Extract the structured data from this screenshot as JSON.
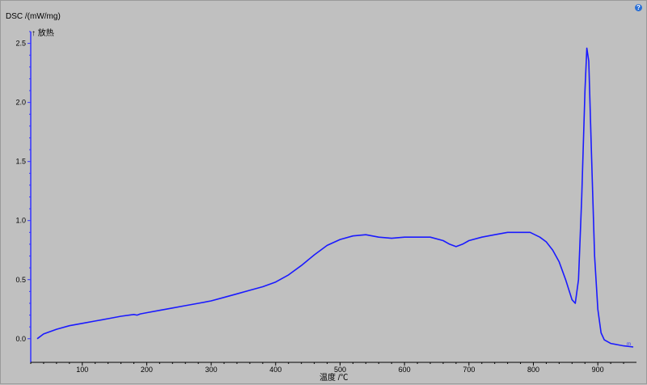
{
  "help_icon": "?",
  "chart_data": {
    "type": "line",
    "ylabel": "DSC /(mW/mg)",
    "exo_label": "↑ 放热",
    "xlabel": "温度 /℃",
    "xlim": [
      20,
      960
    ],
    "ylim": [
      -0.2,
      2.6
    ],
    "xticks": [
      100,
      200,
      300,
      400,
      500,
      600,
      700,
      800,
      900
    ],
    "yticks": [
      0.0,
      0.5,
      1.0,
      1.5,
      2.0,
      2.5
    ],
    "ytick_labels": [
      "0.0",
      "0.5",
      "1.0",
      "1.5",
      "2.0",
      "2.5"
    ],
    "grid": false,
    "line_color": "#1a1aff",
    "axis_color": "#3333ff",
    "end_marker": "m",
    "series": [
      {
        "x": [
          30,
          40,
          60,
          80,
          100,
          120,
          140,
          160,
          180,
          185,
          190,
          200,
          220,
          240,
          260,
          280,
          300,
          320,
          340,
          360,
          380,
          400,
          420,
          440,
          460,
          480,
          500,
          520,
          540,
          560,
          580,
          600,
          620,
          640,
          660,
          670,
          680,
          690,
          700,
          720,
          740,
          760,
          780,
          795,
          810,
          820,
          830,
          840,
          850,
          860,
          865,
          870,
          875,
          880,
          883,
          886,
          890,
          895,
          900,
          905,
          910,
          920,
          930,
          940,
          955
        ],
        "y": [
          0.0,
          0.04,
          0.08,
          0.11,
          0.13,
          0.15,
          0.17,
          0.19,
          0.205,
          0.2,
          0.21,
          0.22,
          0.24,
          0.26,
          0.28,
          0.3,
          0.32,
          0.35,
          0.38,
          0.41,
          0.44,
          0.48,
          0.54,
          0.62,
          0.71,
          0.79,
          0.84,
          0.87,
          0.88,
          0.86,
          0.85,
          0.86,
          0.86,
          0.86,
          0.83,
          0.8,
          0.78,
          0.8,
          0.83,
          0.86,
          0.88,
          0.9,
          0.9,
          0.9,
          0.86,
          0.82,
          0.75,
          0.65,
          0.5,
          0.33,
          0.3,
          0.5,
          1.2,
          2.1,
          2.46,
          2.35,
          1.6,
          0.7,
          0.25,
          0.05,
          -0.01,
          -0.04,
          -0.05,
          -0.06,
          -0.07
        ]
      }
    ]
  }
}
